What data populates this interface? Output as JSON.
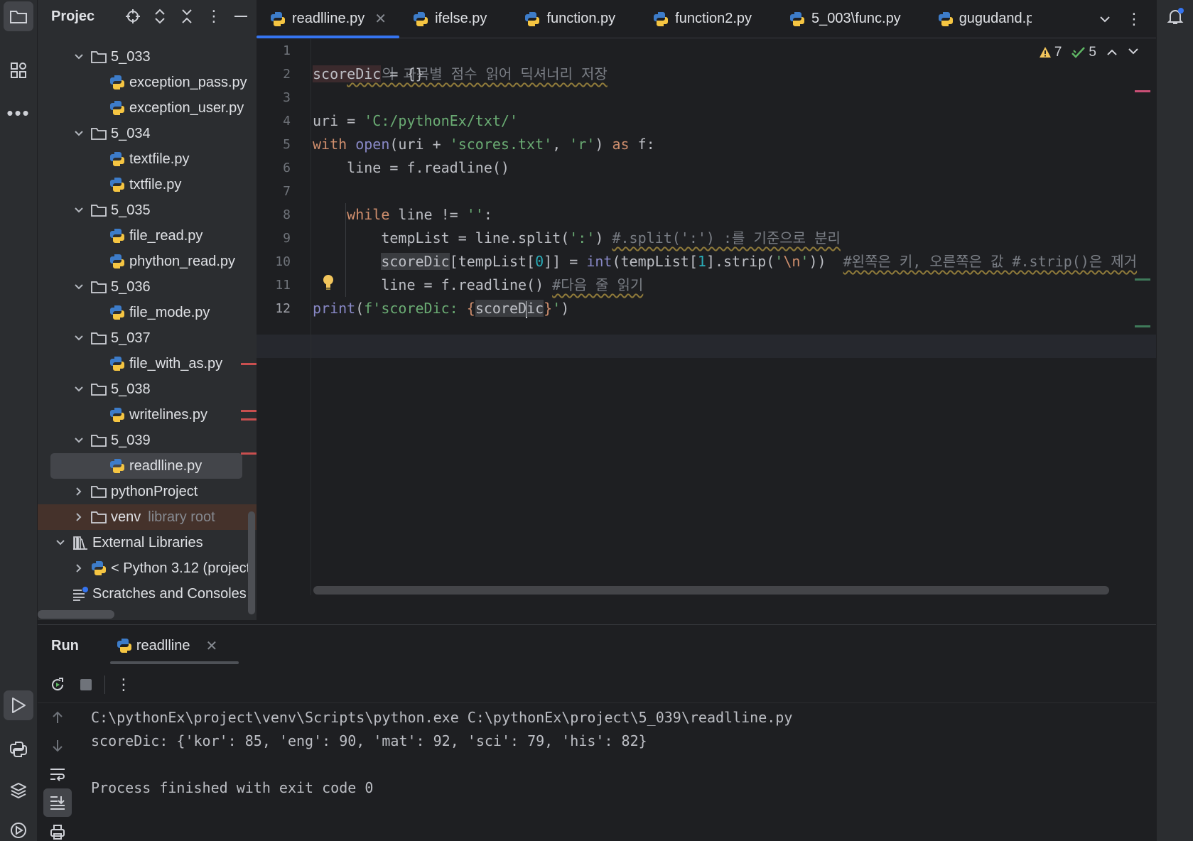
{
  "project_panel": {
    "title": "Projec",
    "tree": [
      {
        "label": "5_033",
        "type": "folder",
        "expanded": true,
        "depth": 1
      },
      {
        "label": "exception_pass.py",
        "type": "py",
        "depth": 2
      },
      {
        "label": "exception_user.py",
        "type": "py",
        "depth": 2
      },
      {
        "label": "5_034",
        "type": "folder",
        "expanded": true,
        "depth": 1
      },
      {
        "label": "textfile.py",
        "type": "py",
        "depth": 2
      },
      {
        "label": "txtfile.py",
        "type": "py",
        "depth": 2
      },
      {
        "label": "5_035",
        "type": "folder",
        "expanded": true,
        "depth": 1
      },
      {
        "label": "file_read.py",
        "type": "py",
        "depth": 2
      },
      {
        "label": "phython_read.py",
        "type": "py",
        "depth": 2
      },
      {
        "label": "5_036",
        "type": "folder",
        "expanded": true,
        "depth": 1
      },
      {
        "label": "file_mode.py",
        "type": "py",
        "depth": 2
      },
      {
        "label": "5_037",
        "type": "folder",
        "expanded": true,
        "depth": 1
      },
      {
        "label": "file_with_as.py",
        "type": "py",
        "depth": 2
      },
      {
        "label": "5_038",
        "type": "folder",
        "expanded": true,
        "depth": 1
      },
      {
        "label": "writelines.py",
        "type": "py",
        "depth": 2
      },
      {
        "label": "5_039",
        "type": "folder",
        "expanded": true,
        "depth": 1
      },
      {
        "label": "readlline.py",
        "type": "py",
        "depth": 2,
        "selected": true
      },
      {
        "label": "pythonProject",
        "type": "folder",
        "expanded": false,
        "depth": 1
      },
      {
        "label": "venv",
        "type": "folder",
        "expanded": false,
        "depth": 1,
        "note": "library root"
      },
      {
        "label": "External Libraries",
        "type": "lib",
        "expanded": true,
        "depth": 0
      },
      {
        "label": "< Python 3.12 (project",
        "type": "py",
        "expanded": false,
        "depth": 1
      },
      {
        "label": "Scratches and Consoles",
        "type": "scratch",
        "depth": 0
      }
    ]
  },
  "tabs": [
    {
      "label": "readlline.py",
      "active": true,
      "closable": true
    },
    {
      "label": "ifelse.py"
    },
    {
      "label": "function.py"
    },
    {
      "label": "function2.py"
    },
    {
      "label": "5_003\\func.py"
    },
    {
      "label": "gugudand.p"
    }
  ],
  "inspections": {
    "warnings": "7",
    "ok": "5"
  },
  "editor": {
    "current_line": 12,
    "line_numbers": [
      "1",
      "2",
      "3",
      "4",
      "5",
      "6",
      "7",
      "8",
      "9",
      "10",
      "11",
      "12"
    ],
    "code": {
      "l1": "#파일의 과목별 점수 읽어 딕셔너리 저장",
      "l2_var": "scoreDic",
      "l2_rest": " = {}",
      "l4_a": "uri = ",
      "l4_str": "'C:/pythonEx/txt/'",
      "l5_with": "with",
      "l5_open": "open",
      "l5_a": "(uri + ",
      "l5_s1": "'scores.txt'",
      "l5_b": ", ",
      "l5_s2": "'r'",
      "l5_c": ") ",
      "l5_as": "as",
      "l5_d": " f:",
      "l6": "    line = f.readline()",
      "l8_ind": "    ",
      "l8_while": "while",
      "l8_a": " line != ",
      "l8_s": "''",
      "l8_b": ":",
      "l9_a": "        tempList = line.split(",
      "l9_s": "':'",
      "l9_b": ") ",
      "l9_c": "#.split(':') :를 기준으로 분리",
      "l10_ind": "        ",
      "l10_var": "scoreDic",
      "l10_a": "[tempList[",
      "l10_n0": "0",
      "l10_b": "]] = ",
      "l10_int": "int",
      "l10_c": "(tempList[",
      "l10_n1": "1",
      "l10_d": "].strip(",
      "l10_q1": "'",
      "l10_esc": "\\n",
      "l10_q2": "'",
      "l10_e": "))  ",
      "l10_cmt": "#왼쪽은 키, 오른쪽은 값 #.strip()은 제거",
      "l11_a": "        line = f.readline() ",
      "l11_c": "#다음 줄 읽기",
      "l12_print": "print",
      "l12_a": "(",
      "l12_s1": "f'scoreDic: ",
      "l12_b1": "{",
      "l12_v1": "scoreD",
      "l12_v2": "ic",
      "l12_b2": "}",
      "l12_s2": "'",
      "l12_c": ")"
    }
  },
  "run_panel": {
    "title": "Run",
    "tab_label": "readlline",
    "console": [
      "C:\\pythonEx\\project\\venv\\Scripts\\python.exe C:\\pythonEx\\project\\5_039\\readlline.py",
      "scoreDic: {'kor': 85, 'eng': 90, 'mat': 92, 'sci': 79, 'his': 82}",
      "",
      "Process finished with exit code 0"
    ]
  },
  "colors": {
    "accent": "#3574f0",
    "keyword": "#cf8e6d",
    "string": "#6aab73",
    "comment": "#7a7e85",
    "number": "#2aacb8",
    "builtin": "#8888c6",
    "python_blue": "#3d7cc9",
    "python_yellow": "#f5c542"
  }
}
